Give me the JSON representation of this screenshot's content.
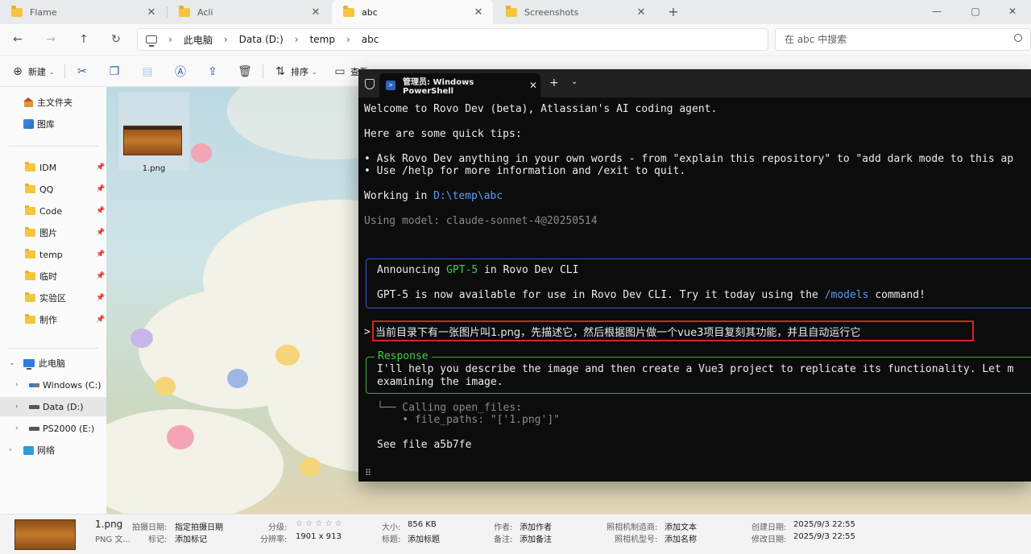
{
  "explorer": {
    "tabs": [
      {
        "label": "Flame",
        "close": "✕"
      },
      {
        "label": "Acli",
        "close": "✕"
      },
      {
        "label": "abc",
        "close": "✕"
      },
      {
        "label": "Screenshots",
        "close": "✕"
      }
    ],
    "new_tab": "+",
    "window_controls": {
      "minimize": "—",
      "maximize": "▢",
      "close": "✕"
    },
    "nav": {
      "back": "←",
      "forward": "→",
      "up": "↑",
      "refresh": "↻"
    },
    "breadcrumb": [
      "此电脑",
      "Data (D:)",
      "temp",
      "abc"
    ],
    "search_placeholder": "在 abc 中搜索",
    "commands": {
      "new": "新建",
      "sort": "排序",
      "view": "查看"
    },
    "sidebar": {
      "quick": [
        "主文件夹",
        "图库"
      ],
      "pinned": [
        "IDM",
        "QQ",
        "Code",
        "图片",
        "temp",
        "临时",
        "实验区",
        "制作"
      ],
      "this_pc": "此电脑",
      "drives": [
        "Windows (C:)",
        "Data (D:)",
        "PS2000 (E:)"
      ],
      "network": "网络"
    },
    "file": {
      "name": "1.png"
    }
  },
  "terminal": {
    "tab_title": "管理员: Windows PowerShell",
    "tab_close": "✕",
    "plus": "+",
    "dropdown": "⌄",
    "welcome": "Welcome to Rovo Dev (beta), Atlassian's AI coding agent.",
    "tips_header": "Here are some quick tips:",
    "tip1": "• Ask Rovo Dev anything in your own words - from \"explain this repository\" to \"add dark mode to this ap",
    "tip2": "• Use /help for more information and /exit to quit.",
    "working_label": "Working in ",
    "working_path": "D:\\temp\\abc",
    "model_line": "Using model: claude-sonnet-4@20250514",
    "announce_pre": "Announcing ",
    "announce_model": "GPT-5",
    "announce_post": " in Rovo Dev CLI",
    "announce_body_pre": "GPT-5 is now available for use in Rovo Dev CLI. Try it today using the ",
    "announce_cmd": "/models",
    "announce_body_post": " command!",
    "prompt_marker": ">",
    "prompt_text": "当前目录下有一张图片叫1.png，先描述它，然后根据图片做一个vue3项目复刻其功能，并且自动运行它",
    "response_title": "Response",
    "response_line1": "I'll help you describe the image and then create a Vue3 project to replicate its functionality. Let m",
    "response_line2": "examining the image.",
    "call_line1": "└── Calling open_files:",
    "call_line2": "    • file_paths: \"['1.png']\"",
    "see_file": "See file a5b7fe",
    "grip": "⠿"
  },
  "details": {
    "name": "1.png",
    "type": "PNG 文...",
    "rows": [
      [
        {
          "k": "拍摄日期:",
          "v": "指定拍摄日期"
        },
        {
          "k": "标记:",
          "v": "添加标记"
        }
      ],
      [
        {
          "k": "分级:",
          "v": "☆ ☆ ☆ ☆ ☆"
        },
        {
          "k": "分辨率:",
          "v": "1901 x 913"
        }
      ],
      [
        {
          "k": "大小:",
          "v": "856 KB"
        },
        {
          "k": "标题:",
          "v": "添加标题"
        }
      ],
      [
        {
          "k": "作者:",
          "v": "添加作者"
        },
        {
          "k": "备注:",
          "v": "添加备注"
        }
      ],
      [
        {
          "k": "照相机制造商:",
          "v": "添加文本"
        },
        {
          "k": "照相机型号:",
          "v": "添加名称"
        }
      ],
      [
        {
          "k": "创建日期:",
          "v": "2025/9/3 22:55"
        },
        {
          "k": "修改日期:",
          "v": "2025/9/3 22:55"
        }
      ]
    ]
  }
}
